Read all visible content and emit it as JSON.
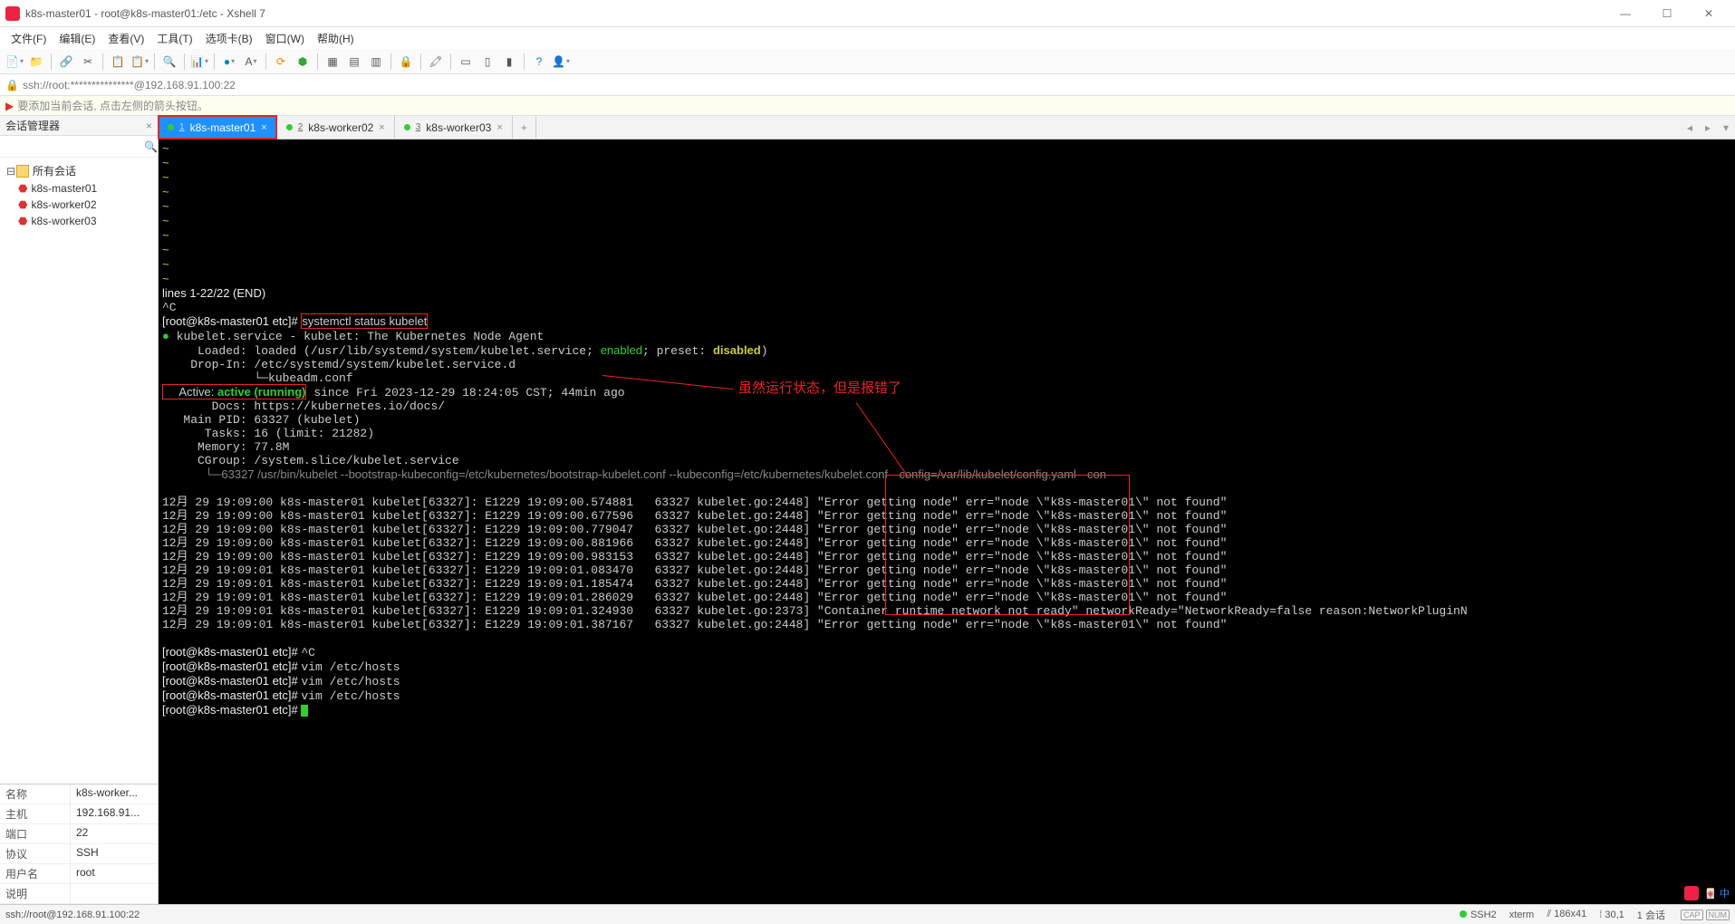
{
  "window": {
    "title": "k8s-master01 - root@k8s-master01:/etc - Xshell 7",
    "min": "—",
    "max": "☐",
    "close": "✕"
  },
  "menu": [
    "文件(F)",
    "编辑(E)",
    "查看(V)",
    "工具(T)",
    "选项卡(B)",
    "窗口(W)",
    "帮助(H)"
  ],
  "address": {
    "lock": "🔒",
    "text": "ssh://root:***************@192.168.91.100:22"
  },
  "hint": {
    "flag": "▶",
    "text": "要添加当前会话, 点击左侧的箭头按钮。"
  },
  "sidebar": {
    "title": "会话管理器",
    "tree_root": "所有会话",
    "sessions": [
      "k8s-master01",
      "k8s-worker02",
      "k8s-worker03"
    ],
    "props": [
      {
        "k": "名称",
        "v": "k8s-worker..."
      },
      {
        "k": "主机",
        "v": "192.168.91..."
      },
      {
        "k": "端口",
        "v": "22"
      },
      {
        "k": "协议",
        "v": "SSH"
      },
      {
        "k": "用户名",
        "v": "root"
      },
      {
        "k": "说明",
        "v": ""
      }
    ]
  },
  "tabs": {
    "items": [
      {
        "num": "1",
        "label": "k8s-master01",
        "active": true
      },
      {
        "num": "2",
        "label": "k8s-worker02",
        "active": false
      },
      {
        "num": "3",
        "label": "k8s-worker03",
        "active": false
      }
    ],
    "add": "+"
  },
  "terminal": {
    "tilde": "~",
    "pager": "lines 1-22/22 (END)",
    "ctrlc": "^C",
    "prompt": "[root@k8s-master01 etc]# ",
    "cmd_status": "systemctl status kubelet",
    "svc_bullet": "●",
    "svc_line": "kubelet.service - kubelet: The Kubernetes Node Agent",
    "loaded_pre": "     Loaded: loaded (/usr/lib/systemd/system/kubelet.service; ",
    "enabled": "enabled",
    "loaded_mid": "; preset: ",
    "disabled": "disabled",
    "loaded_post": ")",
    "dropin": "    Drop-In: /etc/systemd/system/kubelet.service.d",
    "dropin2": "             └─kubeadm.conf",
    "active_lbl": "     Active: ",
    "active_val": "active (running)",
    "active_post": " since Fri 2023-12-29 18:24:05 CST; 44min ago",
    "docs": "       Docs: https://kubernetes.io/docs/",
    "mainpid": "   Main PID: 63327 (kubelet)",
    "tasks": "      Tasks: 16 (limit: 21282)",
    "memory": "     Memory: 77.8M",
    "cgroup": "     CGroup: /system.slice/kubelet.service",
    "cgroup2": "             └─63327 /usr/bin/kubelet --bootstrap-kubeconfig=/etc/kubernetes/bootstrap-kubelet.conf --kubeconfig=/etc/kubernetes/kubelet.conf --config=/var/lib/kubelet/config.yaml --con",
    "log_prefix": "12月 29 19:09:",
    "logs": [
      {
        "t": "00",
        "host": "k8s-master01 kubelet[63327]:",
        "ev": "E1229 19:09:00.574881",
        "rest": "63327 kubelet.go:2448] \"Error getting node\" ",
        "err": "err=\"node \\\"k8s-master01\\\" not found\""
      },
      {
        "t": "00",
        "host": "k8s-master01 kubelet[63327]:",
        "ev": "E1229 19:09:00.677596",
        "rest": "63327 kubelet.go:2448] \"Error getting node\" ",
        "err": "err=\"node \\\"k8s-master01\\\" not found\""
      },
      {
        "t": "00",
        "host": "k8s-master01 kubelet[63327]:",
        "ev": "E1229 19:09:00.779047",
        "rest": "63327 kubelet.go:2448] \"Error getting node\" ",
        "err": "err=\"node \\\"k8s-master01\\\" not found\""
      },
      {
        "t": "00",
        "host": "k8s-master01 kubelet[63327]:",
        "ev": "E1229 19:09:00.881966",
        "rest": "63327 kubelet.go:2448] \"Error getting node\" ",
        "err": "err=\"node \\\"k8s-master01\\\" not found\""
      },
      {
        "t": "00",
        "host": "k8s-master01 kubelet[63327]:",
        "ev": "E1229 19:09:00.983153",
        "rest": "63327 kubelet.go:2448] \"Error getting node\" ",
        "err": "err=\"node \\\"k8s-master01\\\" not found\""
      },
      {
        "t": "01",
        "host": "k8s-master01 kubelet[63327]:",
        "ev": "E1229 19:09:01.083470",
        "rest": "63327 kubelet.go:2448] \"Error getting node\" ",
        "err": "err=\"node \\\"k8s-master01\\\" not found\""
      },
      {
        "t": "01",
        "host": "k8s-master01 kubelet[63327]:",
        "ev": "E1229 19:09:01.185474",
        "rest": "63327 kubelet.go:2448] \"Error getting node\" ",
        "err": "err=\"node \\\"k8s-master01\\\" not found\""
      },
      {
        "t": "01",
        "host": "k8s-master01 kubelet[63327]:",
        "ev": "E1229 19:09:01.286029",
        "rest": "63327 kubelet.go:2448] \"Error getting node\" ",
        "err": "err=\"node \\\"k8s-master01\\\" not found\""
      },
      {
        "t": "01",
        "host": "k8s-master01 kubelet[63327]:",
        "ev": "E1229 19:09:01.324930",
        "rest": "63327 kubelet.go:2373] \"Container runtime network not ready\" networkReady=\"NetworkReady=false reason:NetworkPluginN",
        "err": ""
      },
      {
        "t": "01",
        "host": "k8s-master01 kubelet[63327]:",
        "ev": "E1229 19:09:01.387167",
        "rest": "63327 kubelet.go:2448] \"Error getting node\" ",
        "err": "err=\"node \\\"k8s-master01\\\" not found\""
      }
    ],
    "cmd_ctrlc": "^C",
    "cmd_vim": "vim /etc/hosts",
    "annotation": "虽然运行状态，但是报错了"
  },
  "status": {
    "left": "ssh://root@192.168.91.100:22",
    "ssh": "SSH2",
    "term": "xterm",
    "size": "186x41",
    "rc": "30,1",
    "sess": "1 会话",
    "caps": [
      "CAP",
      "NUM"
    ]
  }
}
